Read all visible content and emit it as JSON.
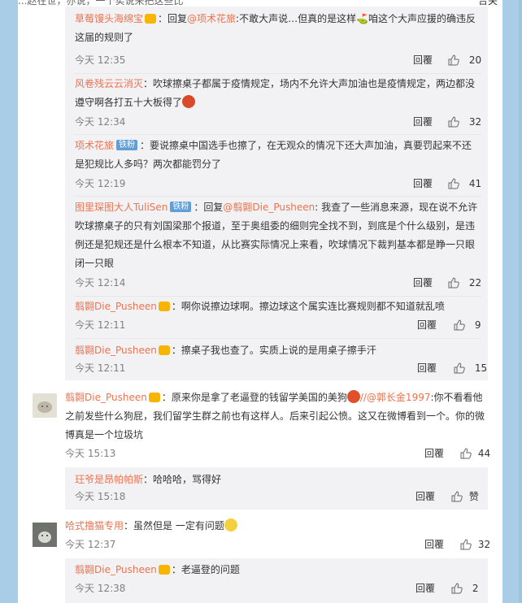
{
  "topbar": {
    "left": "...赵在世，亦说，一个实说来把这些比",
    "right": "合关"
  },
  "like_icon": "thumbs-up-icon",
  "replies_a": [
    {
      "user": "草莓馒头海绵宝",
      "prefix": "：回复",
      "mention": "@项术花旅",
      "text": ":不敢大声说…但真的是这样⛳咱这个大声应援的确违反这届的规则了",
      "time": "今天 12:35",
      "reply_label": "回覆",
      "likes": "20"
    },
    {
      "user": "风卷残云云消灭",
      "prefix": "：",
      "text": "吹球擦桌子都属于疫情规定，场内不允许大声加油也是疫情规定，两边都没遵守啊各打五十大板得了",
      "time": "今天 12:34",
      "reply_label": "回覆",
      "likes": "32"
    },
    {
      "user": "项术花旅",
      "badge": "铁粉",
      "prefix": "：",
      "text": "要说擦桌中国选手也擦了，在无观众的情况下还大声加油，真要罚起来不还是犯规比人多吗？两次都能罚分了",
      "time": "今天 12:19",
      "reply_label": "回覆",
      "likes": "41"
    },
    {
      "user": "图里琛图大人TuliSen",
      "badge": "铁粉",
      "prefix": "：回复",
      "mention": "@翦翾Die_Pusheen",
      "text": ": 我查了一些消息来源，现在说不允许吹球擦桌子的只有刘国梁那个报道，至于奥组委的细则完全找不到，到底是个什么级别，是违例还是犯规还是什么根本不知道，从比赛实际情况上来看，吹球情况下裁判基本都是睁一只眼闭一只眼",
      "time": "今天 12:14",
      "reply_label": "回覆",
      "likes": "22"
    },
    {
      "user": "翦翾Die_Pusheen",
      "prefix": "：",
      "text": "啊你说擦边球啊。擦边球这个属实连比赛规则都不知道就乱喷",
      "time": "今天 12:11",
      "reply_label": "回覆",
      "likes": "9"
    },
    {
      "user": "翦翾Die_Pusheen",
      "prefix": "：",
      "text": "擦桌子我也查了。实质上说的是用桌子擦手汗",
      "time": "今天 12:11",
      "reply_label": "回覆",
      "likes": "15"
    }
  ],
  "comment_b": {
    "user": "翦翾Die_Pusheen",
    "prefix": "：原来你是拿了老逼登的钱留学美国的美狗",
    "mention": "//@郭长金1997",
    "text": ":你不看看他之前发些什么狗屁，我们留学生群之前也有这样人。后来引起公愤。这又在微博看到一个。你的微博真是一个垃圾坑",
    "time": "今天 15:13",
    "reply_label": "回覆",
    "likes": "44",
    "reply": {
      "user": "玨爷是昂帕帕斯",
      "prefix": "：",
      "text": "哈哈哈，骂得好",
      "time": "今天 15:18",
      "reply_label": "回覆",
      "likes": "赞"
    }
  },
  "comment_c": {
    "user": "哈式撸猫专用",
    "prefix": "：",
    "text": "虽然但是 一定有问题",
    "time": "今天 12:37",
    "reply_label": "回覆",
    "likes": "32",
    "reply": {
      "user": "翦翾Die_Pusheen",
      "prefix": "：",
      "text": "老逼登的问题",
      "time": "今天 12:38",
      "reply_label": "回覆",
      "likes": "2"
    }
  },
  "colors": {
    "username": "#eb7350",
    "reply_bg": "#f2f2f5",
    "page_bg": "#a9cde6"
  }
}
